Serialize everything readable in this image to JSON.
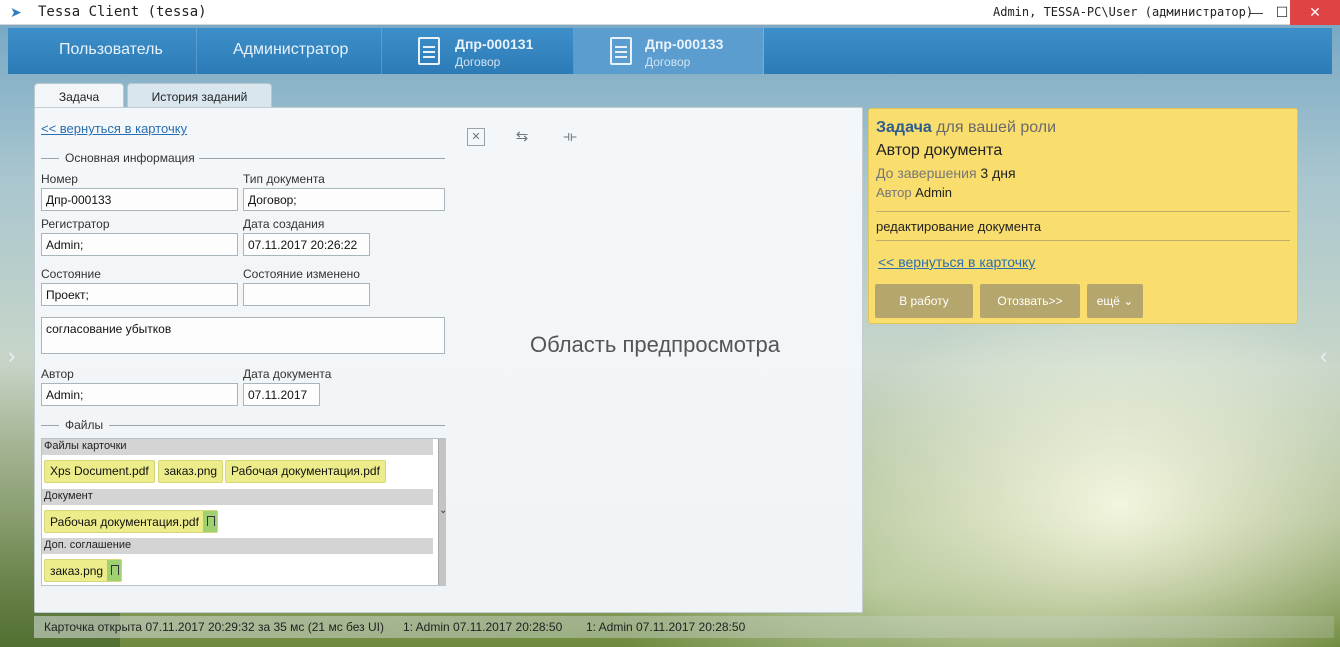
{
  "window": {
    "title": "Tessa Client (tessa)",
    "user": "Admin, TESSA-PC\\User (администратор)",
    "minimize_glyph": "—",
    "maximize_glyph": "☐",
    "close_glyph": "✕"
  },
  "nav": {
    "tabs": [
      {
        "label": "Пользователь"
      },
      {
        "label": "Администратор"
      }
    ],
    "cards": [
      {
        "number": "Дпр-000131",
        "type": "Договор",
        "active": false
      },
      {
        "number": "Дпр-000133",
        "type": "Договор",
        "active": true
      }
    ]
  },
  "content_tabs": [
    "Задача",
    "История заданий"
  ],
  "card": {
    "back_link": "<< вернуться в карточку",
    "section_main": "Основная информация",
    "fields": {
      "number_label": "Номер",
      "number_value": "Дпр-000133",
      "doctype_label": "Тип документа",
      "doctype_value": "Договор;",
      "registrar_label": "Регистратор",
      "registrar_value": "Admin;",
      "created_label": "Дата создания",
      "created_value": "07.11.2017  20:26:22",
      "state_label": "Состояние",
      "state_value": "Проект;",
      "state_changed_label": "Состояние изменено",
      "state_changed_value": "",
      "subject_value": "согласование убытков",
      "author_label": "Автор",
      "author_value": "Admin;",
      "docdate_label": "Дата документа",
      "docdate_value": "07.11.2017"
    },
    "section_files": "Файлы",
    "file_groups": [
      {
        "name": "Файлы карточки",
        "files": [
          "Xps Document.pdf",
          "заказ.png",
          "Рабочая документация.pdf"
        ]
      },
      {
        "name": "Документ",
        "files": [
          "Рабочая документация.pdf"
        ]
      },
      {
        "name": "Доп. соглашение",
        "files": [
          "заказ.png"
        ]
      }
    ],
    "preview_tools": [
      "close-preview-icon",
      "swap-icon",
      "split-icon"
    ],
    "preview_placeholder": "Область предпросмотра"
  },
  "task": {
    "heading": "Задача",
    "role": "для вашей роли",
    "name": "Автор документа",
    "due_label": "До завершения",
    "due_value": "3 дня",
    "author_label": "Автор",
    "author_value": "Admin",
    "description": "редактирование документа",
    "back_link": "<< вернуться в карточку",
    "buttons": [
      "В работу",
      "Отозвать>>",
      "ещё ⌄"
    ]
  },
  "status": {
    "opened": "Карточка открыта 07.11.2017 20:29:32 за 35 мс (21 мс без UI)",
    "entry1": "1:  Admin  07.11.2017 20:28:50",
    "entry2": "1:  Admin  07.11.2017 20:28:50"
  },
  "colors": {
    "nav_bar": "#2c7bb7",
    "task_panel": "#f9dd6d",
    "file_chip": "#ecec8a",
    "link": "#2a6fb1",
    "close_button": "#e04343"
  }
}
